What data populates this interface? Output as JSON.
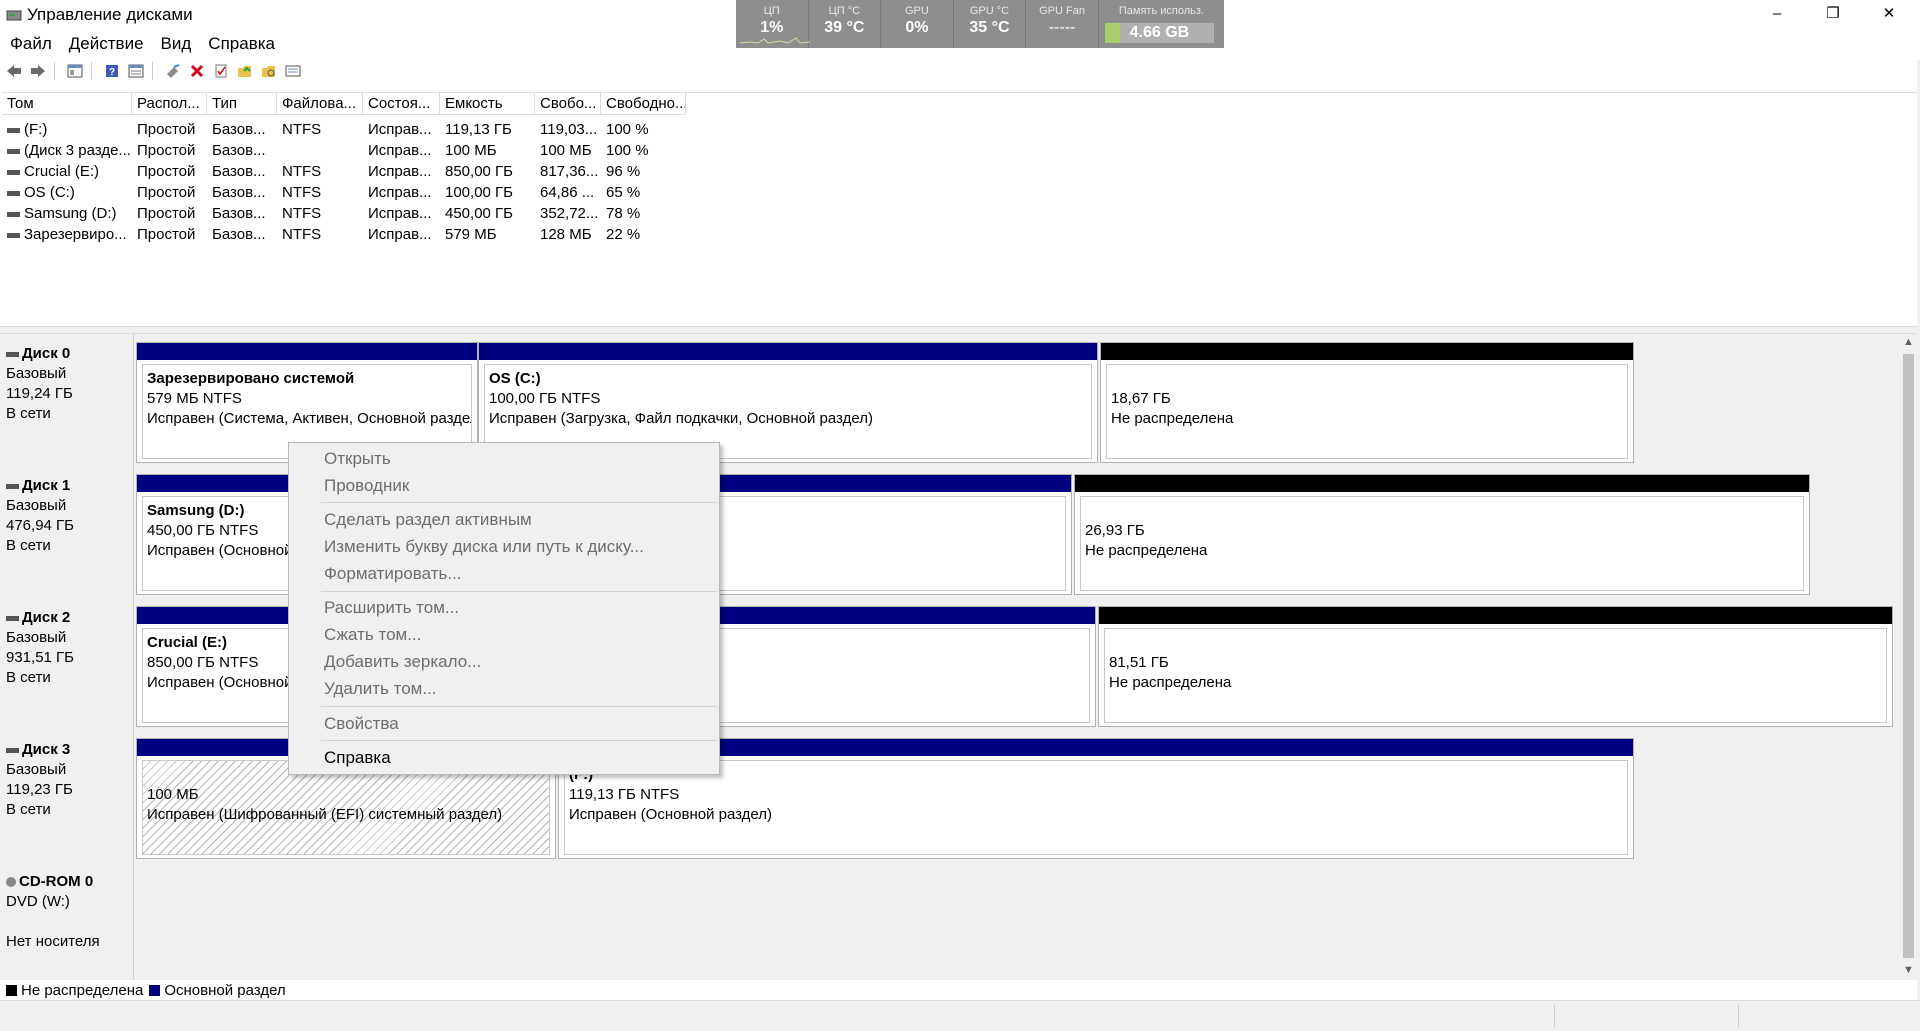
{
  "window": {
    "title": "Управление дисками",
    "controls": {
      "minimize": "–",
      "maximize": "❐",
      "close": "✕"
    }
  },
  "monitor": {
    "cpu": {
      "label": "ЦП",
      "value": "1%"
    },
    "cpu_temp": {
      "label": "ЦП °C",
      "value": "39 °C"
    },
    "gpu": {
      "label": "GPU",
      "value": "0%"
    },
    "gpu_temp": {
      "label": "GPU °C",
      "value": "35 °C"
    },
    "gpu_fan": {
      "label": "GPU Fan",
      "value": "-----"
    },
    "memory": {
      "label": "Память использ.",
      "value": "4.66 GB",
      "fill_fraction": 0.14,
      "fill_color": "#a8cf6b"
    }
  },
  "menu": [
    "Файл",
    "Действие",
    "Вид",
    "Справка"
  ],
  "toolbar": {
    "icons": [
      "back-icon",
      "forward-icon",
      "console-tree-icon",
      "help-icon",
      "properties-icon",
      "connect-icon",
      "delete-icon",
      "check-icon",
      "new-folder-icon",
      "explore-icon",
      "list-icon"
    ]
  },
  "volume_table": {
    "columns": [
      "Том",
      "Распол...",
      "Тип",
      "Файлова...",
      "Состоя...",
      "Емкость",
      "Свобо...",
      "Свободно..."
    ],
    "rows": [
      [
        "(F:)",
        "Простой",
        "Базов...",
        "NTFS",
        "Исправ...",
        "119,13 ГБ",
        "119,03...",
        "100 %"
      ],
      [
        "(Диск 3 разде...",
        "Простой",
        "Базов...",
        "",
        "Исправ...",
        "100 МБ",
        "100 МБ",
        "100 %"
      ],
      [
        "Crucial (E:)",
        "Простой",
        "Базов...",
        "NTFS",
        "Исправ...",
        "850,00 ГБ",
        "817,36...",
        "96 %"
      ],
      [
        "OS (C:)",
        "Простой",
        "Базов...",
        "NTFS",
        "Исправ...",
        "100,00 ГБ",
        "64,86 ...",
        "65 %"
      ],
      [
        "Samsung (D:)",
        "Простой",
        "Базов...",
        "NTFS",
        "Исправ...",
        "450,00 ГБ",
        "352,72...",
        "78 %"
      ],
      [
        "Зарезервиро...",
        "Простой",
        "Базов...",
        "NTFS",
        "Исправ...",
        "579 МБ",
        "128 МБ",
        "22 %"
      ]
    ]
  },
  "disks": [
    {
      "name": "Диск 0",
      "type": "Базовый",
      "size": "119,24 ГБ",
      "status": "В сети",
      "partitions": [
        {
          "name": "Зарезервировано системой",
          "size": "579 МБ NTFS",
          "status": "Исправен (Система, Активен, Основной раздел)",
          "kind": "primary"
        },
        {
          "name": "OS  (C:)",
          "size": "100,00 ГБ NTFS",
          "status": "Исправен (Загрузка, Файл подкачки, Основной раздел)",
          "kind": "primary"
        },
        {
          "name": "",
          "size": "18,67 ГБ",
          "status": "Не распределена",
          "kind": "unallocated"
        }
      ]
    },
    {
      "name": "Диск 1",
      "type": "Базовый",
      "size": "476,94 ГБ",
      "status": "В сети",
      "partitions": [
        {
          "name": "Samsung  (D:)",
          "size": "450,00 ГБ NTFS",
          "status": "Исправен (Основной раздел)",
          "kind": "primary"
        },
        {
          "name": "",
          "size": "26,93 ГБ",
          "status": "Не распределена",
          "kind": "unallocated"
        }
      ]
    },
    {
      "name": "Диск 2",
      "type": "Базовый",
      "size": "931,51 ГБ",
      "status": "В сети",
      "partitions": [
        {
          "name": "Crucial  (E:)",
          "size": "850,00 ГБ NTFS",
          "status": "Исправен (Основной раздел)",
          "kind": "primary"
        },
        {
          "name": "",
          "size": "81,51 ГБ",
          "status": "Не распределена",
          "kind": "unallocated"
        }
      ]
    },
    {
      "name": "Диск 3",
      "type": "Базовый",
      "size": "119,23 ГБ",
      "status": "В сети",
      "partitions": [
        {
          "name": "",
          "size": "100 МБ",
          "status": "Исправен (Шифрованный (EFI) системный раздел)",
          "kind": "efi"
        },
        {
          "name": "(F:)",
          "size": "119,13 ГБ NTFS",
          "status": "Исправен (Основной раздел)",
          "kind": "primary"
        }
      ]
    },
    {
      "name": "CD-ROM 0",
      "type": "DVD (W:)",
      "size": "",
      "status": "Нет носителя",
      "partitions": []
    }
  ],
  "legend": [
    {
      "label": "Не распределена",
      "color": "#000000"
    },
    {
      "label": "Основной раздел",
      "color": "#000080"
    }
  ],
  "context_menu": {
    "items": [
      {
        "label": "Открыть",
        "enabled": false
      },
      {
        "label": "Проводник",
        "enabled": false
      },
      {
        "label": "Сделать раздел активным",
        "enabled": false
      },
      {
        "label": "Изменить букву диска или путь к диску...",
        "enabled": false
      },
      {
        "label": "Форматировать...",
        "enabled": false
      },
      {
        "label": "Расширить том...",
        "enabled": false
      },
      {
        "label": "Сжать том...",
        "enabled": false
      },
      {
        "label": "Добавить зеркало...",
        "enabled": false
      },
      {
        "label": "Удалить том...",
        "enabled": false
      },
      {
        "label": "Свойства",
        "enabled": false
      },
      {
        "label": "Справка",
        "enabled": true
      }
    ]
  },
  "colors": {
    "primary": "#000080",
    "unallocated": "#000000",
    "background": "#f0f0f0"
  }
}
